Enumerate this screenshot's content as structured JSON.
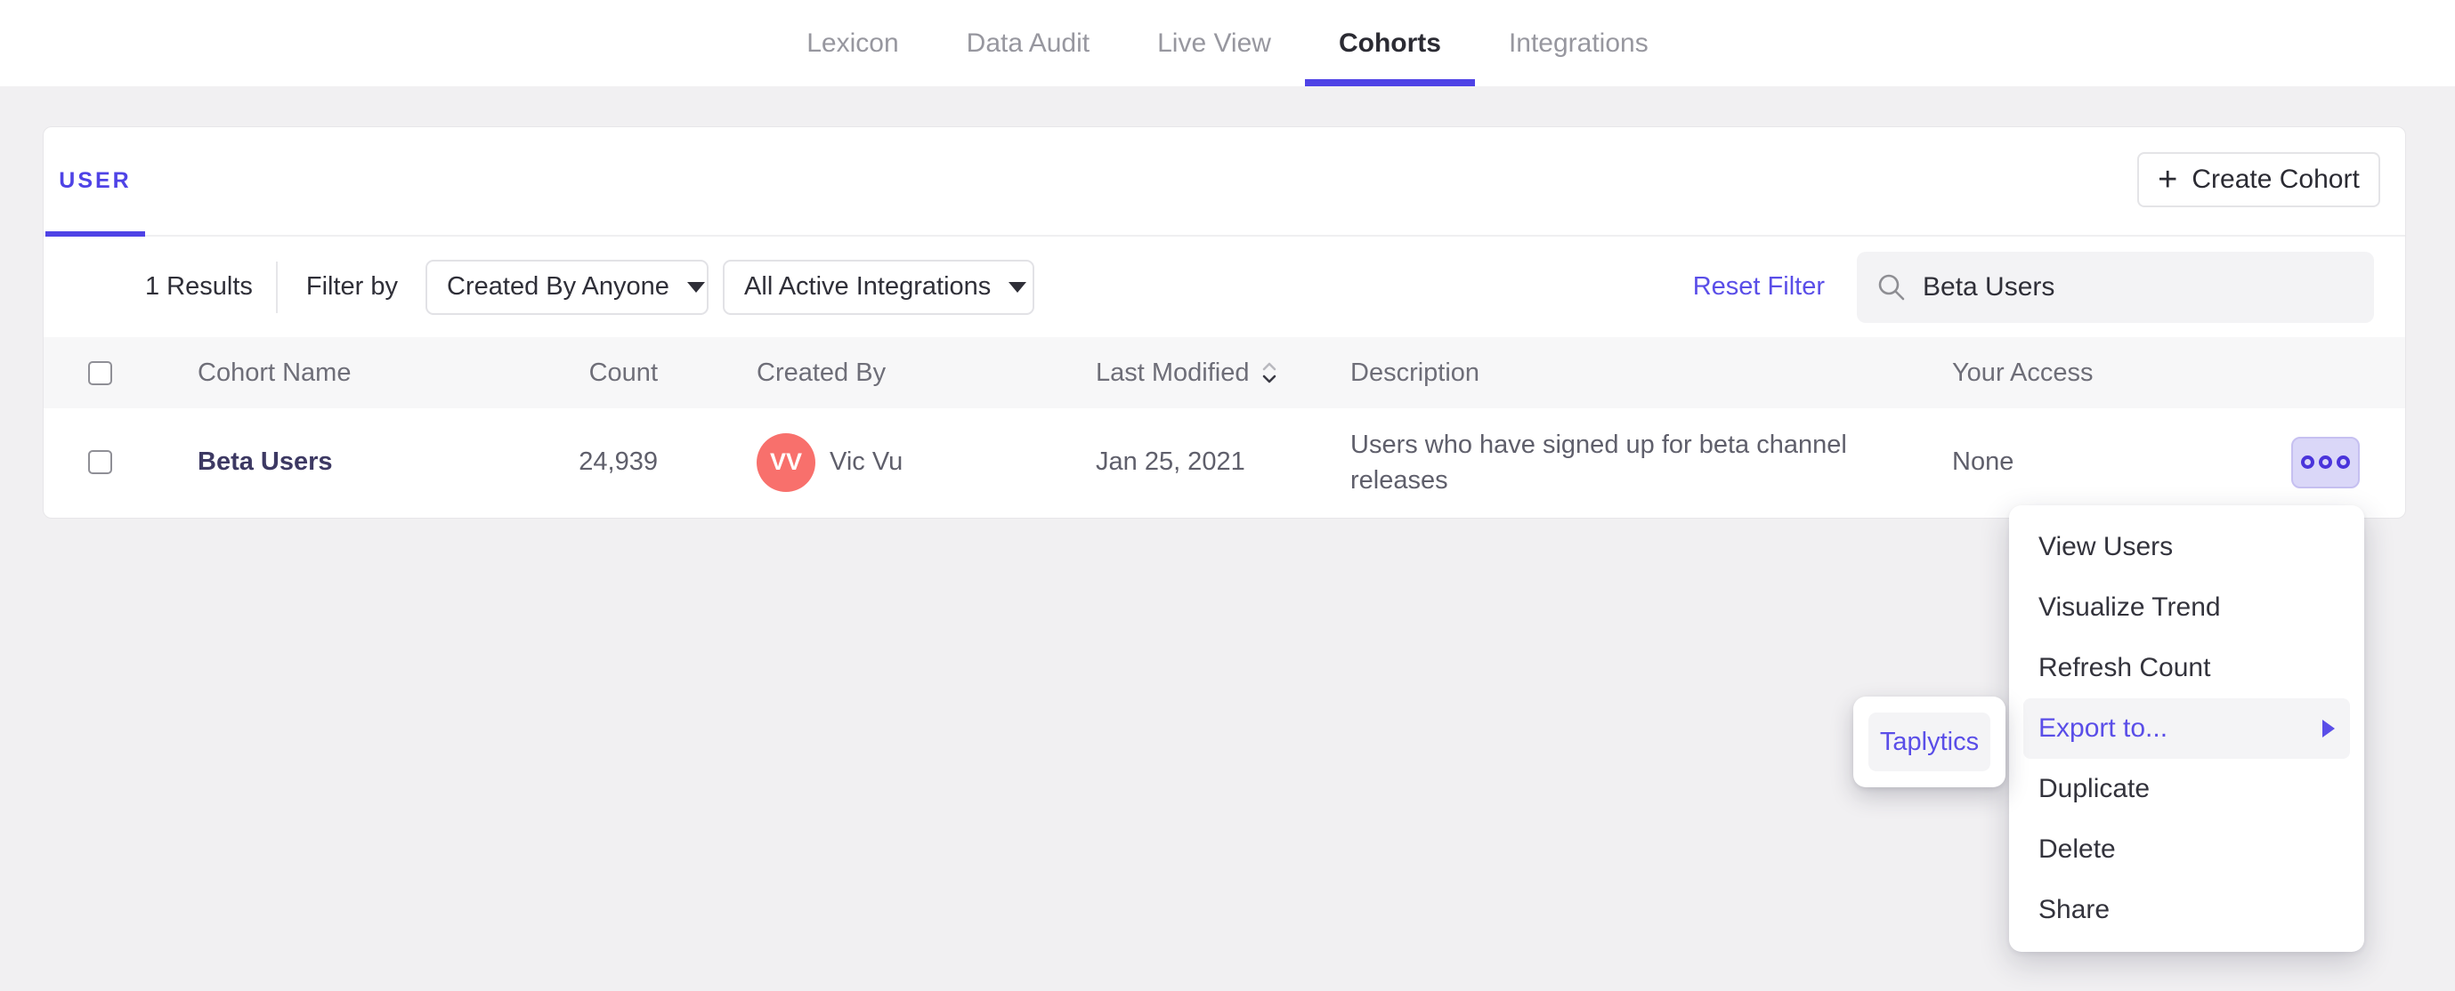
{
  "nav": {
    "items": [
      {
        "label": "Lexicon"
      },
      {
        "label": "Data Audit"
      },
      {
        "label": "Live View"
      },
      {
        "label": "Cohorts"
      },
      {
        "label": "Integrations"
      }
    ],
    "active_tab": "Cohorts"
  },
  "panel": {
    "tab_label": "USER",
    "create_cohort": {
      "icon": "+",
      "label": "Create Cohort"
    },
    "filters": {
      "results_count": "1 Results",
      "filter_by_label": "Filter by",
      "created_by_value": "Created By Anyone",
      "integrations_value": "All Active Integrations",
      "reset_label": "Reset Filter",
      "search_value": "Beta Users"
    },
    "table": {
      "columns": {
        "name": "Cohort Name",
        "count": "Count",
        "created_by": "Created By",
        "last_modified": "Last Modified",
        "description": "Description",
        "access": "Your Access"
      },
      "sort": {
        "column": "Last Modified",
        "direction": "descending"
      },
      "rows": [
        {
          "name": "Beta Users",
          "count": "24,939",
          "creator_initials": "VV",
          "creator_name": "Vic Vu",
          "last_modified": "Jan 25, 2021",
          "description": "Users who have signed up for beta channel releases",
          "access": "None"
        }
      ]
    }
  },
  "context_menu": {
    "items": [
      {
        "label": "View Users"
      },
      {
        "label": "Visualize Trend"
      },
      {
        "label": "Refresh Count"
      },
      {
        "label": "Export to...",
        "highlighted": true,
        "has_submenu": true
      },
      {
        "label": "Duplicate"
      },
      {
        "label": "Delete"
      },
      {
        "label": "Share"
      }
    ]
  },
  "export_submenu": {
    "items": [
      {
        "label": "Taplytics",
        "highlighted": true
      }
    ]
  },
  "icons": {
    "search": "search-icon",
    "sort": "sort-chevrons-icon",
    "more": "ellipsis-icon",
    "caret": "chevron-down-icon",
    "plus": "plus-icon"
  },
  "colors": {
    "accent_purple": "#4F43E6",
    "link_purple": "#5A4EE8",
    "avatar_red": "#F8706C",
    "cohort_name_navy": "#3D3963",
    "more_button_bg": "#DAD7F8",
    "more_button_dots": "#4A34DB",
    "page_bg": "#F1F0F2",
    "table_header_bg": "#F7F7F8",
    "menu_highlight_bg": "#F4F4F6"
  }
}
